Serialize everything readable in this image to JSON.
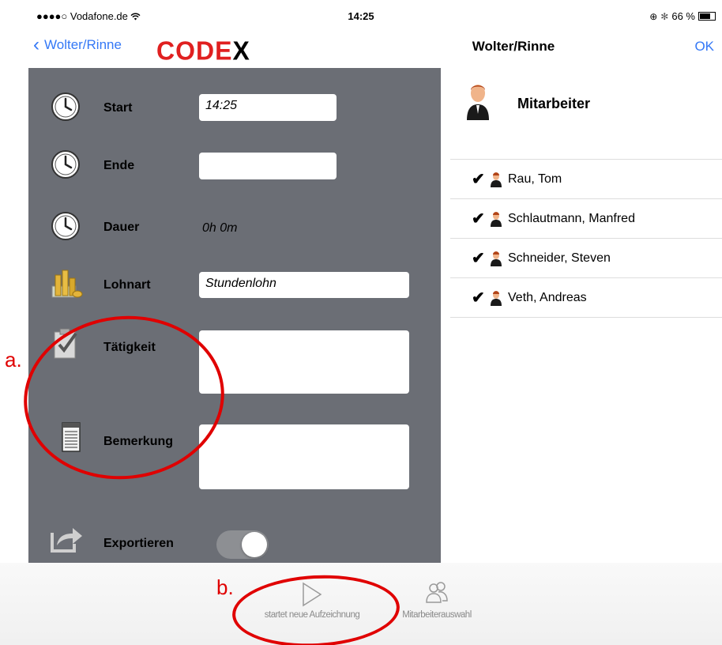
{
  "status_bar": {
    "carrier": "●●●●○ Vodafone.de",
    "time": "14:25",
    "battery_text": "66 %"
  },
  "nav": {
    "back_label": "Wolter/Rinne",
    "logo_text_main": "CODE",
    "logo_text_x": "X",
    "title": "Wolter/Rinne",
    "ok_label": "OK"
  },
  "form": {
    "start_label": "Start",
    "start_value": "14:25",
    "ende_label": "Ende",
    "ende_value": "",
    "dauer_label": "Dauer",
    "dauer_value": "0h 0m",
    "lohnart_label": "Lohnart",
    "lohnart_value": "Stundenlohn",
    "taetigkeit_label": "Tätigkeit",
    "taetigkeit_value": "",
    "bemerkung_label": "Bemerkung",
    "bemerkung_value": "",
    "exportieren_label": "Exportieren",
    "export_on": true
  },
  "employees": {
    "header": "Mitarbeiter",
    "items": [
      {
        "name": "Rau, Tom",
        "checked": true
      },
      {
        "name": "Schlautmann, Manfred",
        "checked": true
      },
      {
        "name": "Schneider, Steven",
        "checked": true
      },
      {
        "name": "Veth, Andreas",
        "checked": true
      }
    ]
  },
  "tabbar": {
    "start_label": "startet neue Aufzeichnung",
    "select_label": "Mitarbeiterauswahl"
  },
  "annotations": {
    "a": "a.",
    "b": "b."
  },
  "colors": {
    "accent": "#3478f6",
    "panel": "#6b6e75",
    "annotation": "#e00000",
    "logo": "#e02020"
  }
}
